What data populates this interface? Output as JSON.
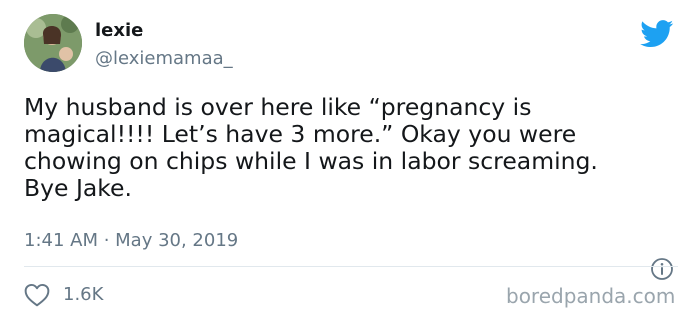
{
  "user": {
    "display_name": "lexie",
    "handle": "@lexiemamaa_"
  },
  "tweet": {
    "text": "My husband is over here like “pregnancy is\nmagical!!!! Let’s have 3 more.” Okay you were\nchowing on chips while I was in labor screaming.\nBye Jake.",
    "timestamp": "1:41 AM · May 30, 2019",
    "like_count": "1.6K"
  },
  "watermark": "boredpanda.com",
  "colors": {
    "text_primary": "#14171a",
    "text_secondary": "#657786",
    "twitter_blue": "#1da1f2",
    "divider": "#e1e8ed"
  },
  "icons": {
    "brand": "twitter-bird-icon",
    "info": "info-icon",
    "like": "heart-icon"
  }
}
